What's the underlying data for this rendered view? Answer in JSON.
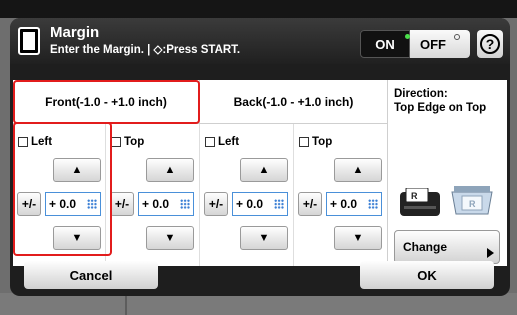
{
  "header": {
    "title": "Margin",
    "subtitle": "Enter the Margin. | ◇:Press START.",
    "toggle_on": "ON",
    "toggle_off": "OFF",
    "help_label": "?"
  },
  "tabs": {
    "front": "Front(-1.0 - +1.0 inch)",
    "back": "Back(-1.0 - +1.0 inch)"
  },
  "columns": [
    {
      "label": "Left",
      "value": "+ 0.0"
    },
    {
      "label": "Top",
      "value": "+ 0.0"
    },
    {
      "label": "Left",
      "value": "+ 0.0"
    },
    {
      "label": "Top",
      "value": "+ 0.0"
    }
  ],
  "controls": {
    "up_arrow": "▲",
    "down_arrow": "▼",
    "plus_minus": "+/-"
  },
  "direction": {
    "label_line1": "Direction:",
    "label_line2": "Top Edge on Top",
    "change_label": "Change",
    "printer_glyph": "R",
    "scanner_glyph": "R"
  },
  "footer": {
    "cancel": "Cancel",
    "ok": "OK"
  },
  "colors": {
    "highlight": "#e21c1c",
    "field_border": "#4a90d9"
  }
}
